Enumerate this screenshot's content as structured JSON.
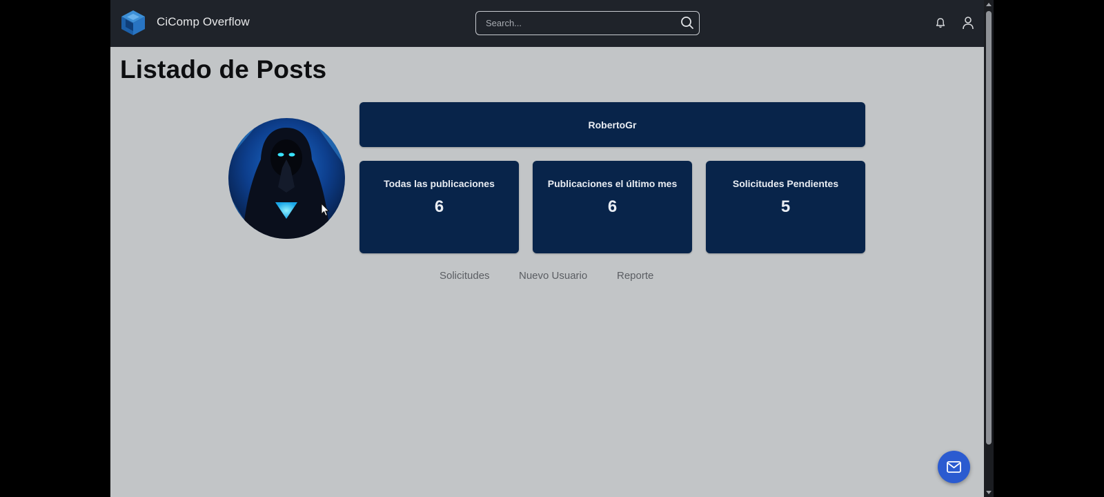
{
  "navbar": {
    "brand_name": "CiComp Overflow",
    "search_placeholder": "Search...",
    "icons": [
      "logo-icon",
      "search-icon",
      "bell-icon",
      "user-icon"
    ]
  },
  "page": {
    "title": "Listado de Posts"
  },
  "profile": {
    "username": "RobertoGr"
  },
  "stats": [
    {
      "label": "Todas las publicaciones",
      "value": "6"
    },
    {
      "label": "Publicaciones el último mes",
      "value": "6"
    },
    {
      "label": "Solicitudes Pendientes",
      "value": "5"
    }
  ],
  "actions": [
    {
      "label": "Solicitudes"
    },
    {
      "label": "Nuevo Usuario"
    },
    {
      "label": "Reporte"
    }
  ],
  "fab": {
    "icon": "mail-icon"
  },
  "colors": {
    "navbar_bg": "#1f232a",
    "page_bg": "#c2c5c7",
    "card_bg": "#08244a",
    "fab_bg": "#2b5bd0",
    "link_text": "#5a5d62"
  }
}
